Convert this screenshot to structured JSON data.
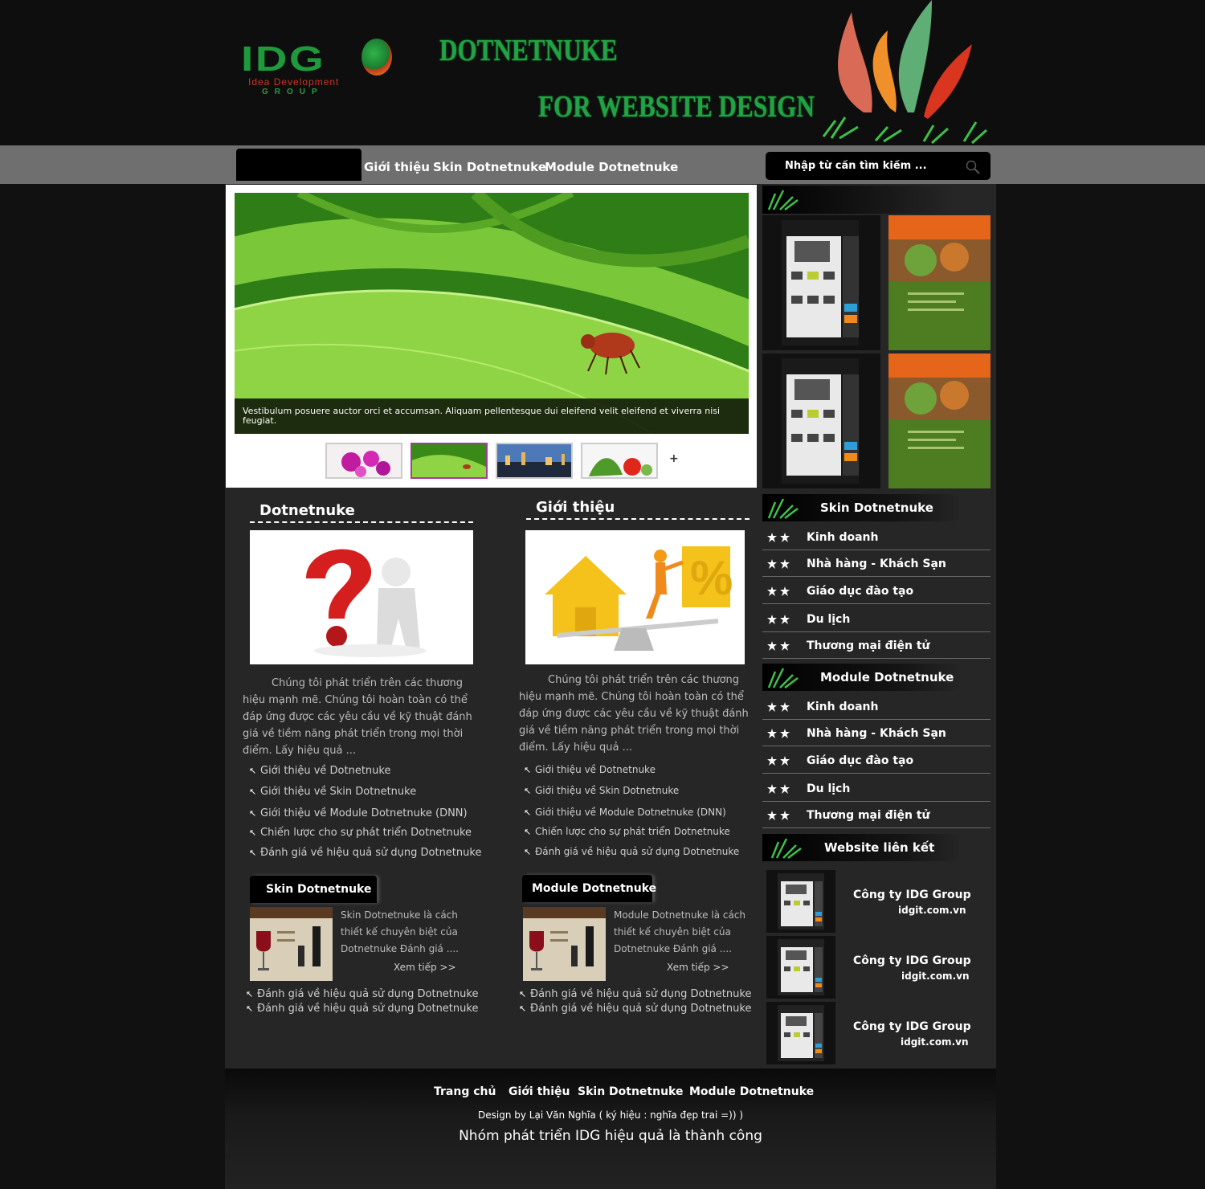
{
  "header": {
    "logo_mark": "IDG",
    "logo_sub": "Idea Development",
    "logo_group": "GROUP",
    "title_line1": "DOTNETNUKE",
    "title_line2": "FOR WEBSITE DESIGN"
  },
  "nav": {
    "items": [
      "Giới thiệu",
      "Skin Dotnetnuke",
      "Module Dotnetnuke"
    ]
  },
  "search": {
    "placeholder": "Nhập từ cần tìm kiếm ...",
    "icon": "search-icon"
  },
  "slider": {
    "caption": "Vestibulum posuere auctor orci et accumsan. Aliquam pellentesque dui eleifend velit eleifend et viverra nisi feugiat.",
    "thumbs": [
      "orchid",
      "leaf-beetle",
      "city-night",
      "vegetables"
    ],
    "active_thumb": 2,
    "more": "+"
  },
  "col1": {
    "heading": "Dotnetnuke",
    "paragraph": "Chúng tôi phát triển trên các thương hiệu mạnh mẽ. Chúng tôi hoàn toàn có thể đáp ứng được các yêu cầu về kỹ thuật đánh giá về tiềm năng phát triển trong mọi thời điểm. Lấy hiệu quả ...",
    "links": [
      "Giới thiệu về Dotnetnuke",
      "Giới thiệu về Skin Dotnetnuke",
      "Giới thiệu về Module Dotnetnuke (DNN)",
      "Chiến lược cho sự phát triển Dotnetnuke",
      "Đánh giá về hiệu quả sử dụng Dotnetnuke"
    ],
    "tab": "Skin Dotnetnuke",
    "tab_text": "Skin Dotnetnuke là cách thiết kế chuyên biệt của Dotnetnuke Đánh giá ....",
    "more": "Xem tiếp >>",
    "bottom_links": [
      "Đánh giá về hiệu quả sử dụng Dotnetnuke",
      "Đánh giá về hiệu quả sử dụng Dotnetnuke"
    ]
  },
  "col2": {
    "heading": "Giới thiệu",
    "paragraph": "Chúng tôi phát triển trên các thương hiệu mạnh mẽ. Chúng tôi hoàn toàn có thể đáp ứng được các yêu cầu về kỹ thuật đánh giá về tiềm năng phát triển trong mọi thời điểm. Lấy hiệu quả ...",
    "links": [
      "Giới thiệu về Dotnetnuke",
      "Giới thiệu về Skin Dotnetnuke",
      "Giới thiệu về Module Dotnetnuke (DNN)",
      "Chiến lược cho sự phát triển Dotnetnuke",
      "Đánh giá về hiệu quả sử dụng Dotnetnuke"
    ],
    "tab": "Module Dotnetnuke",
    "tab_text": "Module Dotnetnuke là cách thiết kế chuyên biệt của Dotnetnuke Đánh giá ....",
    "more": "Xem tiếp >>",
    "bottom_links": [
      "Đánh giá về hiệu quả sử dụng Dotnetnuke",
      "Đánh giá về hiệu quả sử dụng Dotnetnuke"
    ]
  },
  "sidebar": {
    "skin_heading": "Skin Dotnetnuke",
    "skin_items": [
      "Kinh doanh",
      "Nhà hàng - Khách Sạn",
      "Giáo dục đào tạo",
      "Du lịch",
      "Thương mại điện tử"
    ],
    "module_heading": "Module Dotnetnuke",
    "module_items": [
      "Kinh doanh",
      "Nhà hàng - Khách Sạn",
      "Giáo dục đào tạo",
      "Du lịch",
      "Thương mại điện tử"
    ],
    "links_heading": "Website liên kết",
    "links": [
      {
        "name": "Công ty IDG Group",
        "url": "idgit.com.vn"
      },
      {
        "name": "Công ty IDG Group",
        "url": "idgit.com.vn"
      },
      {
        "name": "Công ty IDG Group",
        "url": "idgit.com.vn"
      }
    ]
  },
  "footer": {
    "links": [
      "Trang chủ",
      "Giới thiệu",
      "Skin Dotnetnuke",
      "Module Dotnetnuke"
    ],
    "credit": "Design by Lại Văn Nghĩa ( ký hiệu : nghĩa đẹp trai =)) )",
    "slogan": "Nhóm phát triển IDG hiệu quả là thành công"
  },
  "colors": {
    "brand_green": "#24a046",
    "nav_bar": "#6f6f6f",
    "content_bg": "#262626"
  }
}
